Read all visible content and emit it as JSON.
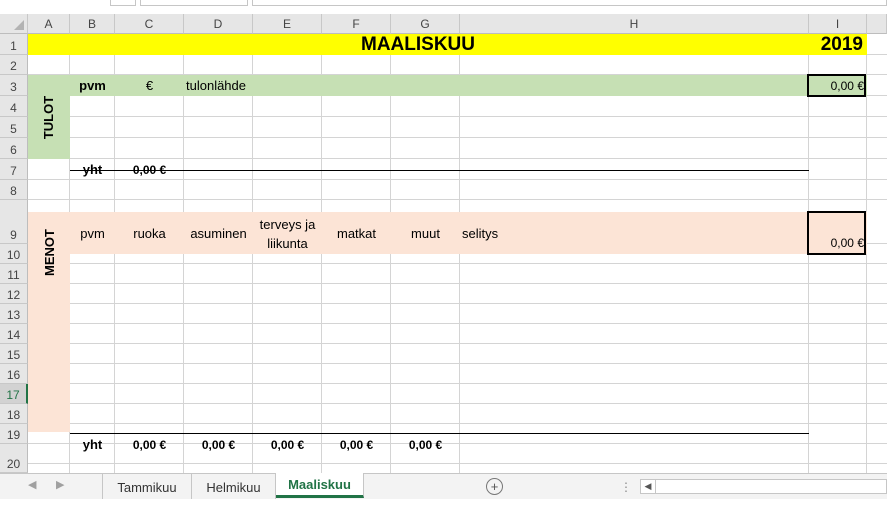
{
  "columns": [
    "A",
    "B",
    "C",
    "D",
    "E",
    "F",
    "G",
    "H",
    "I"
  ],
  "rows": [
    "1",
    "2",
    "3",
    "4",
    "5",
    "6",
    "7",
    "8",
    "9",
    "10",
    "11",
    "12",
    "13",
    "14",
    "15",
    "16",
    "17",
    "18",
    "19",
    "20"
  ],
  "selected_row": "17",
  "title": {
    "month": "MAALISKUU",
    "year": "2019"
  },
  "income": {
    "section_label": "TULOT",
    "headers": {
      "date": "pvm",
      "amount": "€",
      "source": "tulonlähde"
    },
    "balance": "0,00 €",
    "total_label": "yht",
    "total_value": "0,00 €"
  },
  "expenses": {
    "section_label": "MENOT",
    "headers": {
      "date": "pvm",
      "food": "ruoka",
      "housing": "asuminen",
      "health_line1": "terveys ja",
      "health_line2": "liikunta",
      "travel": "matkat",
      "other": "muut",
      "description": "selitys"
    },
    "balance": "0,00 €",
    "total_label": "yht",
    "totals": {
      "food": "0,00 €",
      "housing": "0,00 €",
      "health": "0,00 €",
      "travel": "0,00 €",
      "other": "0,00 €"
    }
  },
  "sheet_tabs": [
    "Tammikuu",
    "Helmikuu",
    "Maaliskuu"
  ],
  "active_tab": "Maaliskuu",
  "icons": {
    "nav_prev": "triangle-left-icon",
    "nav_next": "triangle-right-icon",
    "add_sheet": "plus-circle-icon",
    "scroll_left": "triangle-left-icon"
  },
  "colors": {
    "title_fill": "#ffff00",
    "income_fill": "#c6e0b4",
    "expense_fill": "#fce4d6",
    "accent": "#217346"
  }
}
